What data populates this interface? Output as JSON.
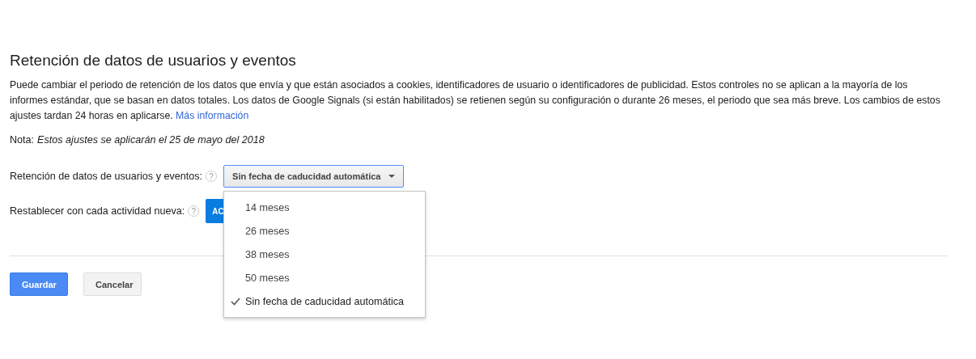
{
  "title": "Retención de datos de usuarios y eventos",
  "description": "Puede cambiar el periodo de retención de los datos que envía y que están asociados a cookies, identificadores de usuario o identificadores de publicidad. Estos controles no se aplican a la mayoría de los informes estándar, que se basan en datos totales. Los datos de Google Signals (si están habilitados) se retienen según su configuración o durante 26 meses, el periodo que sea más breve. Los cambios de estos ajustes tardan 24 horas en aplicarse.",
  "more_link": "Más información",
  "note": {
    "label": "Nota:",
    "text": "Estos ajustes se aplicarán el 25 de mayo del 2018"
  },
  "retention": {
    "label": "Retención de datos de usuarios y eventos:",
    "help": "?",
    "value": "Sin fecha de caducidad automática",
    "expanded": true,
    "options": [
      {
        "label": "14 meses",
        "selected": false
      },
      {
        "label": "26 meses",
        "selected": false
      },
      {
        "label": "38 meses",
        "selected": false
      },
      {
        "label": "50 meses",
        "selected": false
      },
      {
        "label": "Sin fecha de caducidad automática",
        "selected": true
      }
    ]
  },
  "reset": {
    "label": "Restablecer con cada actividad nueva:",
    "help": "?",
    "toggle_text": "AC"
  },
  "buttons": [
    {
      "label": "Guardar",
      "kind": "primary"
    },
    {
      "label": "Cancelar",
      "kind": "secondary"
    }
  ]
}
